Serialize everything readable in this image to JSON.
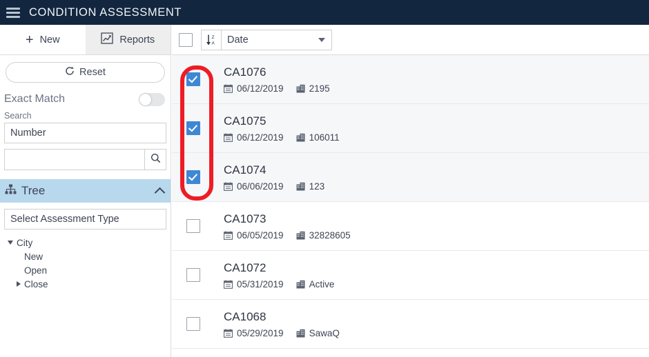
{
  "header": {
    "title": "CONDITION ASSESSMENT",
    "menu_icon": "hamburger-icon",
    "bg_color": "#12263f"
  },
  "sidebar": {
    "tabs": [
      {
        "label": "New",
        "icon": "plus-icon",
        "active": true
      },
      {
        "label": "Reports",
        "icon": "chart-icon",
        "active": false
      }
    ],
    "reset_button": {
      "label": "Reset",
      "icon": "refresh-icon"
    },
    "exact_match": {
      "label": "Exact Match",
      "toggle_state": "off"
    },
    "search_section": {
      "label": "Search",
      "field_select_value": "Number",
      "input_value": "",
      "input_placeholder": "",
      "search_icon": "magnifier-icon"
    },
    "tree_panel": {
      "title": "Tree",
      "icon": "sitemap-icon",
      "collapse_icon": "chevron-up-icon",
      "assessment_type_select": "Select Assessment Type",
      "nodes": [
        {
          "label": "City",
          "expanded": true,
          "level": 0
        },
        {
          "label": "New",
          "expanded": null,
          "level": 1
        },
        {
          "label": "Open",
          "expanded": null,
          "level": 1
        },
        {
          "label": "Close",
          "expanded": false,
          "level": 1
        }
      ]
    }
  },
  "list_panel": {
    "toolbar": {
      "select_all_checked": false,
      "sort_icon": "sort-descending-za-icon",
      "sort_by_value": "Date"
    },
    "rows": [
      {
        "title": "CA1076",
        "date": "06/12/2019",
        "date_icon": "calendar-icon",
        "asset": "2195",
        "asset_icon": "building-icon",
        "checked": true
      },
      {
        "title": "CA1075",
        "date": "06/12/2019",
        "date_icon": "calendar-icon",
        "asset": "106011",
        "asset_icon": "building-icon",
        "checked": true
      },
      {
        "title": "CA1074",
        "date": "06/06/2019",
        "date_icon": "calendar-icon",
        "asset": "123",
        "asset_icon": "building-icon",
        "checked": true
      },
      {
        "title": "CA1073",
        "date": "06/05/2019",
        "date_icon": "calendar-icon",
        "asset": "32828605",
        "asset_icon": "building-icon",
        "checked": false
      },
      {
        "title": "CA1072",
        "date": "05/31/2019",
        "date_icon": "calendar-icon",
        "asset": "Active",
        "asset_icon": "building-icon",
        "checked": false
      },
      {
        "title": "CA1068",
        "date": "05/29/2019",
        "date_icon": "calendar-icon",
        "asset": "SawaQ",
        "asset_icon": "building-icon",
        "checked": false
      }
    ]
  },
  "annotation": {
    "shape": "rounded-rectangle",
    "color": "#ee1c25",
    "target": "checkbox-column-of-selected-rows"
  }
}
